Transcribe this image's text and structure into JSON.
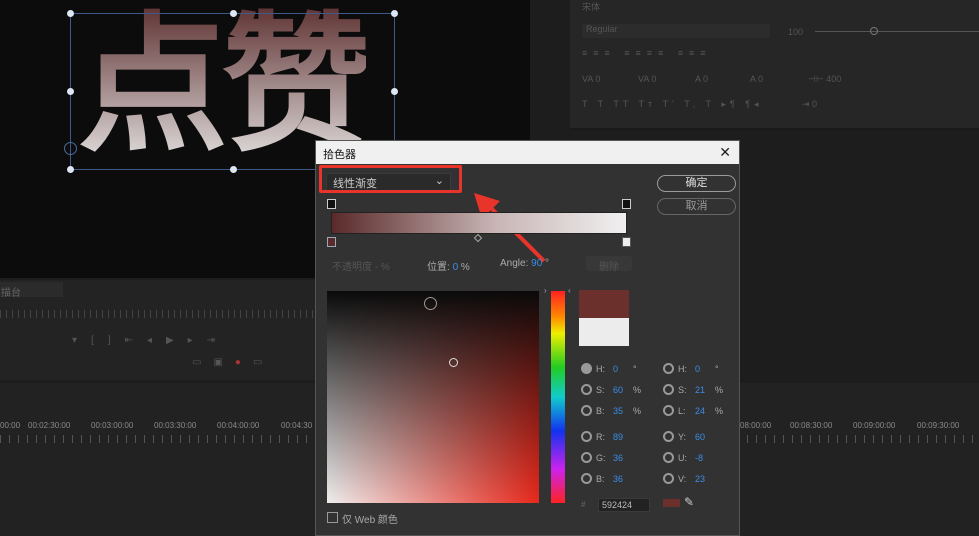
{
  "monitor": {
    "title_text": "点赞"
  },
  "right_panel": {
    "font_family": "宋体",
    "font_style": "Regular",
    "size_value": "100",
    "tracking": "0",
    "kerning": "0",
    "leading": "0",
    "baseline": "0",
    "tsume": "400",
    "indent": "0"
  },
  "lower_panel": {
    "tab_label": "描台"
  },
  "timeline": {
    "timecodes": [
      "00:00",
      "00:02:30:00",
      "00:03:00:00",
      "00:03:30:00",
      "00:04:00:00",
      "00:04:30",
      "08:00:00",
      "00:08:30:00",
      "00:09:00:00",
      "00:09:30:00"
    ]
  },
  "dialog": {
    "title": "拾色器",
    "close": "✕",
    "fill_type": "线性渐变",
    "ok_label": "确定",
    "cancel_label": "取消",
    "opacity_label": "不透明度",
    "opacity_unit": "%",
    "position_label": "位置:",
    "position_value": "0",
    "position_unit": "%",
    "angle_label": "Angle:",
    "angle_value": "90",
    "angle_unit": "°",
    "delete_label": "删除",
    "web_only_label": "仅 Web 颜色",
    "hex_prefix": "#",
    "hex_value": "592424",
    "new_color": "#6b2f2c",
    "old_color": "#ececec",
    "fields_left": [
      {
        "label": "H:",
        "value": "0",
        "unit": "°",
        "selected": true
      },
      {
        "label": "S:",
        "value": "60",
        "unit": "%"
      },
      {
        "label": "B:",
        "value": "35",
        "unit": "%"
      },
      {
        "label": "R:",
        "value": "89",
        "unit": ""
      },
      {
        "label": "G:",
        "value": "36",
        "unit": ""
      },
      {
        "label": "B:",
        "value": "36",
        "unit": ""
      }
    ],
    "fields_right": [
      {
        "label": "H:",
        "value": "0",
        "unit": "°"
      },
      {
        "label": "S:",
        "value": "21",
        "unit": "%"
      },
      {
        "label": "L:",
        "value": "24",
        "unit": "%"
      },
      {
        "label": "Y:",
        "value": "60",
        "unit": ""
      },
      {
        "label": "U:",
        "value": "-8",
        "unit": ""
      },
      {
        "label": "V:",
        "value": "23",
        "unit": ""
      }
    ]
  },
  "annotation": {
    "color": "#e8342a"
  }
}
